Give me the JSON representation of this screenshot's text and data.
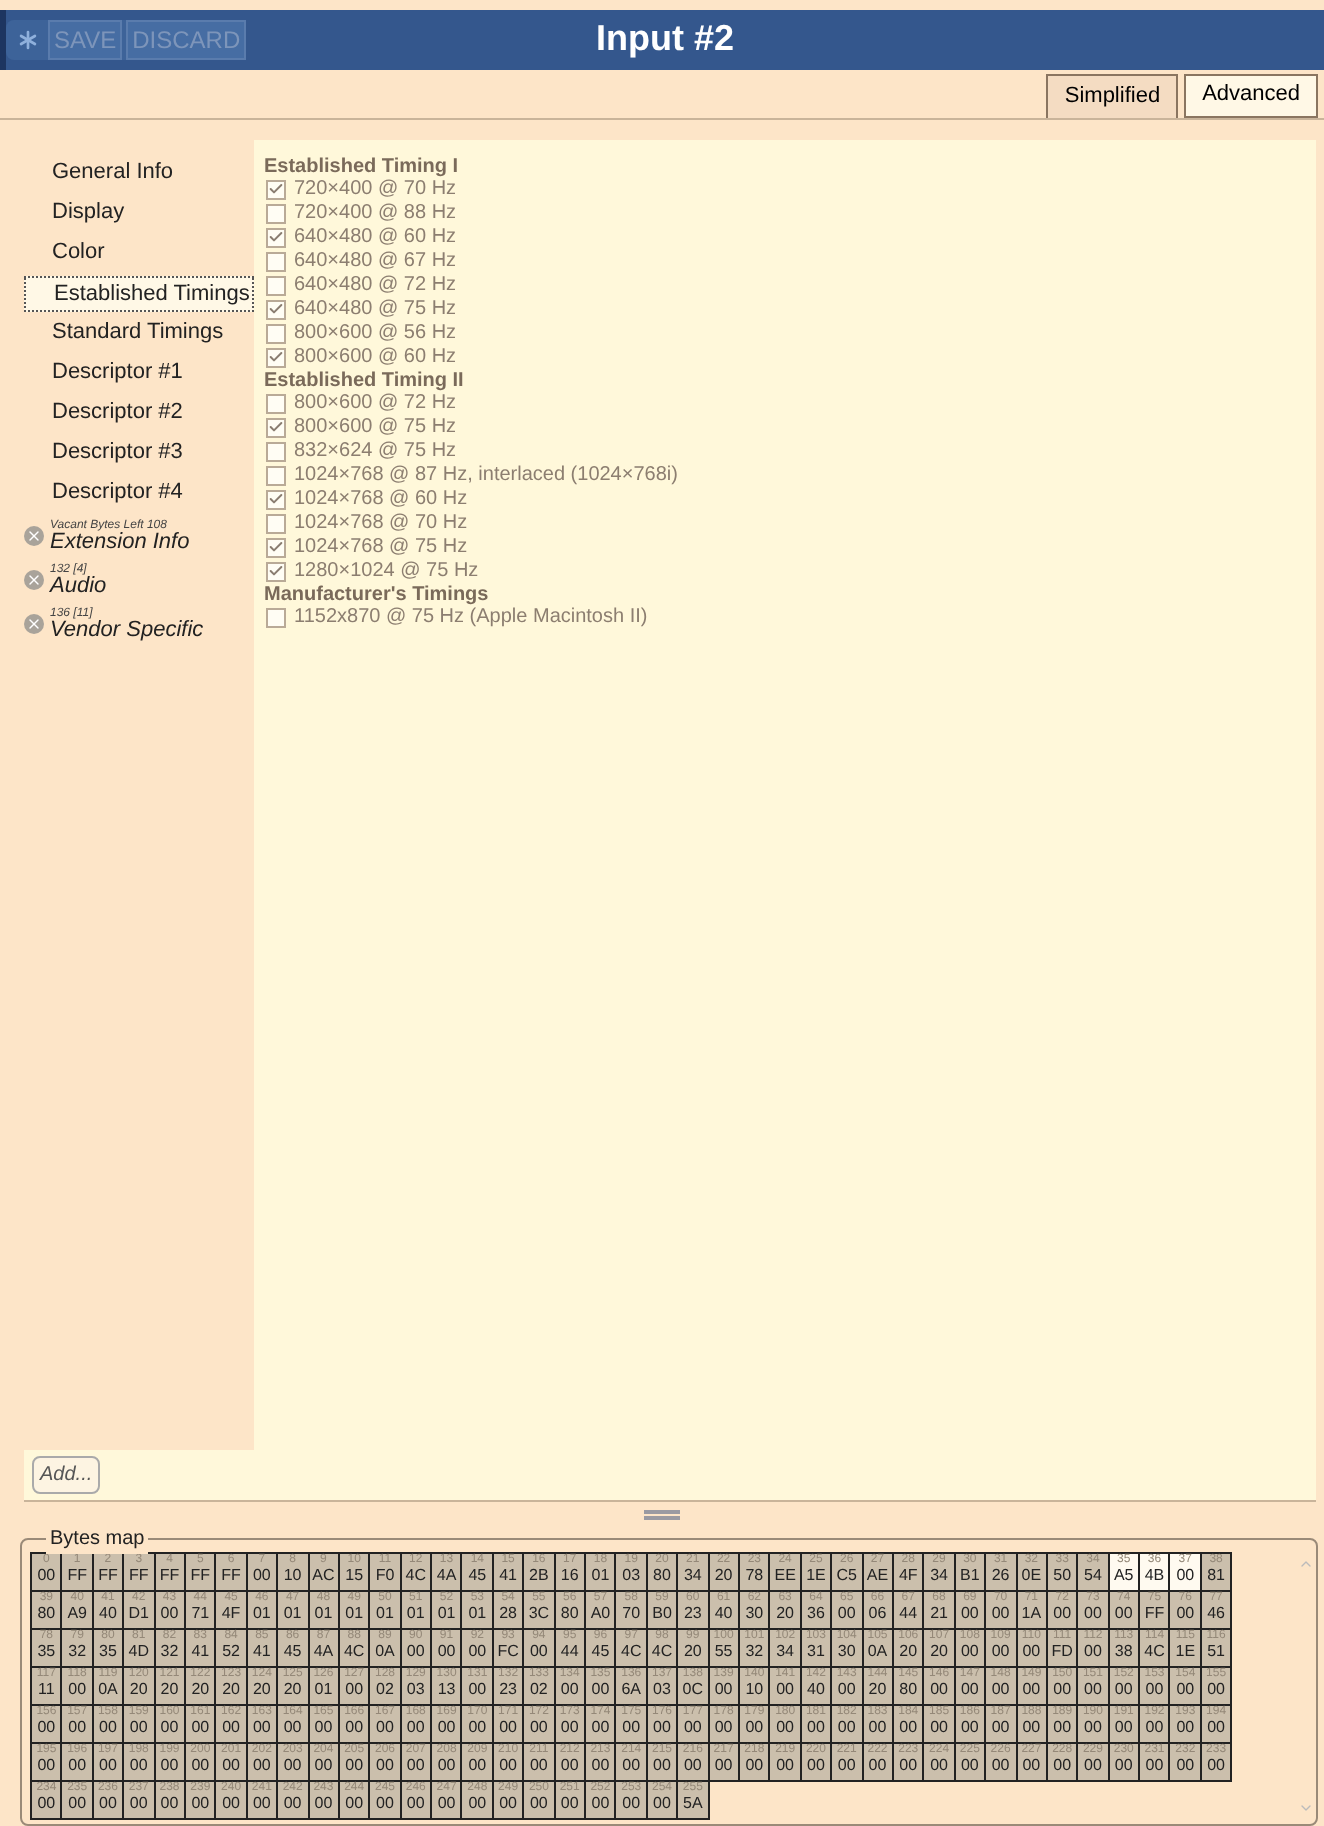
{
  "window": {
    "title": "Input #2"
  },
  "toolbar": {
    "buttons": [
      {
        "label": "SAVE",
        "disabled": true
      },
      {
        "label": "DISCARD",
        "disabled": true
      }
    ]
  },
  "tabs": [
    {
      "label": "Simplified",
      "selected": true
    },
    {
      "label": "Advanced",
      "selected": false
    }
  ],
  "sidebar": {
    "items": [
      {
        "label": "General Info",
        "selected": false
      },
      {
        "label": "Display",
        "selected": false
      },
      {
        "label": "Color",
        "selected": false
      },
      {
        "label": "Established Timings",
        "selected": true
      },
      {
        "label": "Standard Timings",
        "selected": false
      },
      {
        "label": "Descriptor #1",
        "selected": false
      },
      {
        "label": "Descriptor #2",
        "selected": false
      },
      {
        "label": "Descriptor #3",
        "selected": false
      },
      {
        "label": "Descriptor #4",
        "selected": false
      }
    ],
    "extensions": [
      {
        "note": "Vacant Bytes Left 108",
        "label": "Extension Info"
      },
      {
        "note": "132 [4]",
        "label": "Audio"
      },
      {
        "note": "136 [11]",
        "label": "Vendor Specific"
      }
    ],
    "add_button": "Add..."
  },
  "timings": [
    {
      "title": "Established Timing I",
      "items": [
        {
          "label": "720×400 @ 70 Hz",
          "checked": true
        },
        {
          "label": "720×400 @ 88 Hz",
          "checked": false
        },
        {
          "label": "640×480 @ 60 Hz",
          "checked": true
        },
        {
          "label": "640×480 @ 67 Hz",
          "checked": false
        },
        {
          "label": "640×480 @ 72 Hz",
          "checked": false
        },
        {
          "label": "640×480 @ 75 Hz",
          "checked": true
        },
        {
          "label": "800×600 @ 56 Hz",
          "checked": false
        },
        {
          "label": "800×600 @ 60 Hz",
          "checked": true
        }
      ]
    },
    {
      "title": "Established Timing II",
      "items": [
        {
          "label": "800×600 @ 72 Hz",
          "checked": false
        },
        {
          "label": "800×600 @ 75 Hz",
          "checked": true
        },
        {
          "label": "832×624 @ 75 Hz",
          "checked": false
        },
        {
          "label": "1024×768 @ 87 Hz, interlaced (1024×768i)",
          "checked": false
        },
        {
          "label": "1024×768 @ 60 Hz",
          "checked": true
        },
        {
          "label": "1024×768 @ 70 Hz",
          "checked": false
        },
        {
          "label": "1024×768 @ 75 Hz",
          "checked": true
        },
        {
          "label": "1280×1024 @ 75 Hz",
          "checked": true
        }
      ]
    },
    {
      "title": "Manufacturer's Timings",
      "items": [
        {
          "label": "1152x870 @ 75 Hz (Apple Macintosh II)",
          "checked": false
        }
      ]
    }
  ],
  "bytes_map": {
    "title": "Bytes map",
    "rows": [
      {
        "indices": "0 1 2 3 4 5 6 7 8 9 10 11 12 13 14 15 16 17 18 19 20 21 22 23 24 25 26 27 28 29 30 31 32 33 34 35 36 37 38",
        "values": "00 FF FF FF FF FF FF 00 10 AC 15 F0 4C 4A 45 41 2B 16 01 03 80 34 20 78 EE 1E C5 AE 4F 34 B1 26 0E 50 54 A5 4B 00 81",
        "selected": [
          false,
          false,
          false,
          false,
          false,
          false,
          false,
          false,
          false,
          false,
          false,
          false,
          false,
          false,
          false,
          false,
          false,
          false,
          false,
          false,
          false,
          false,
          false,
          false,
          false,
          false,
          false,
          false,
          false,
          false,
          false,
          false,
          false,
          false,
          false,
          true,
          true,
          true,
          false
        ]
      },
      {
        "indices": "39 40 41 42 43 44 45 46 47 48 49 50 51 52 53 54 55 56 57 58 59 60 61 62 63 64 65 66 67 68 69 70 71 72 73 74 75 76 77",
        "values": "80 A9 40 D1 00 71 4F 01 01 01 01 01 01 01 01 28 3C 80 A0 70 B0 23 40 30 20 36 00 06 44 21 00 00 1A 00 00 00 FF 00 46",
        "selected": [
          false,
          false,
          false,
          false,
          false,
          false,
          false,
          false,
          false,
          false,
          false,
          false,
          false,
          false,
          false,
          false,
          false,
          false,
          false,
          false,
          false,
          false,
          false,
          false,
          false,
          false,
          false,
          false,
          false,
          false,
          false,
          false,
          false,
          false,
          false,
          false,
          false,
          false,
          false
        ]
      },
      {
        "indices": "78 79 80 81 82 83 84 85 86 87 88 89 90 91 92 93 94 95 96 97 98 99 100 101 102 103 104 105 106 107 108 109 110 111 112 113 114 115 116",
        "values": "35 32 35 4D 32 41 52 41 45 4A 4C 0A 00 00 00 FC 00 44 45 4C 4C 20 55 32 34 31 30 0A 20 20 00 00 00 FD 00 38 4C 1E 51",
        "selected": [
          false,
          false,
          false,
          false,
          false,
          false,
          false,
          false,
          false,
          false,
          false,
          false,
          false,
          false,
          false,
          false,
          false,
          false,
          false,
          false,
          false,
          false,
          false,
          false,
          false,
          false,
          false,
          false,
          false,
          false,
          false,
          false,
          false,
          false,
          false,
          false,
          false,
          false,
          false
        ]
      },
      {
        "indices": "117 118 119 120 121 122 123 124 125 126 127 128 129 130 131 132 133 134 135 136 137 138 139 140 141 142 143 144 145 146 147 148 149 150 151 152 153 154 155",
        "values": "11 00 0A 20 20 20 20 20 20 01 00 02 03 13 00 23 02 00 00 6A 03 0C 00 10 00 40 00 20 80 00 00 00 00 00 00 00 00 00 00",
        "selected": [
          false,
          false,
          false,
          false,
          false,
          false,
          false,
          false,
          false,
          false,
          false,
          false,
          false,
          false,
          false,
          false,
          false,
          false,
          false,
          false,
          false,
          false,
          false,
          false,
          false,
          false,
          false,
          false,
          false,
          false,
          false,
          false,
          false,
          false,
          false,
          false,
          false,
          false,
          false
        ]
      },
      {
        "indices": "156 157 158 159 160 161 162 163 164 165 166 167 168 169 170 171 172 173 174 175 176 177 178 179 180 181 182 183 184 185 186 187 188 189 190 191 192 193 194",
        "values": "00 00 00 00 00 00 00 00 00 00 00 00 00 00 00 00 00 00 00 00 00 00 00 00 00 00 00 00 00 00 00 00 00 00 00 00 00 00 00",
        "selected": [
          false,
          false,
          false,
          false,
          false,
          false,
          false,
          false,
          false,
          false,
          false,
          false,
          false,
          false,
          false,
          false,
          false,
          false,
          false,
          false,
          false,
          false,
          false,
          false,
          false,
          false,
          false,
          false,
          false,
          false,
          false,
          false,
          false,
          false,
          false,
          false,
          false,
          false,
          false
        ]
      },
      {
        "indices": "195 196 197 198 199 200 201 202 203 204 205 206 207 208 209 210 211 212 213 214 215 216 217 218 219 220 221 222 223 224 225 226 227 228 229 230 231 232 233",
        "values": "00 00 00 00 00 00 00 00 00 00 00 00 00 00 00 00 00 00 00 00 00 00 00 00 00 00 00 00 00 00 00 00 00 00 00 00 00 00 00",
        "selected": [
          false,
          false,
          false,
          false,
          false,
          false,
          false,
          false,
          false,
          false,
          false,
          false,
          false,
          false,
          false,
          false,
          false,
          false,
          false,
          false,
          false,
          false,
          false,
          false,
          false,
          false,
          false,
          false,
          false,
          false,
          false,
          false,
          false,
          false,
          false,
          false,
          false,
          false,
          false
        ]
      },
      {
        "indices": "234 235 236 237 238 239 240 241 242 243 244 245 246 247 248 249 250 251 252 253 254 255",
        "values": "00 00 00 00 00 00 00 00 00 00 00 00 00 00 00 00 00 00 00 00 00 5A",
        "selected": [
          false,
          false,
          false,
          false,
          false,
          false,
          false,
          false,
          false,
          false,
          false,
          false,
          false,
          false,
          false,
          false,
          false,
          false,
          false,
          false,
          false,
          false
        ]
      }
    ]
  }
}
